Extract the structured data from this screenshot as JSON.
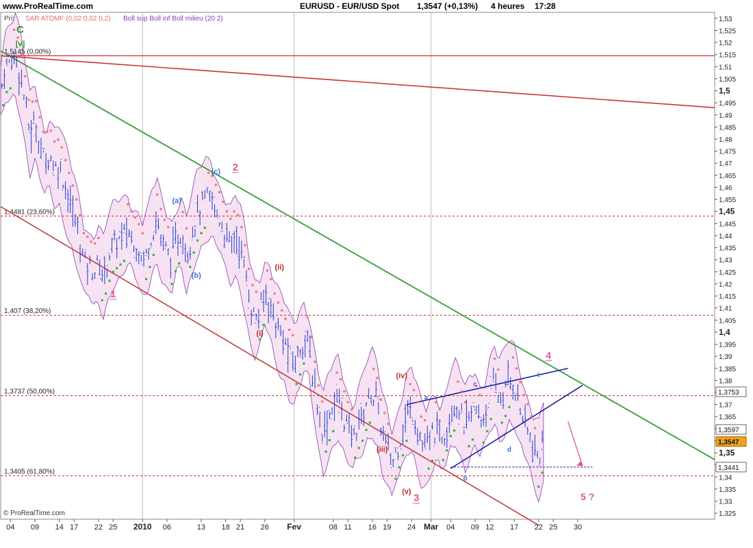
{
  "header": {
    "site": "www.ProRealTime.com",
    "title": "EURUSD - EUR/USD Spot",
    "price": "1,3547 (+0,13%)",
    "period": "4 heures",
    "time": "17:28"
  },
  "legend": {
    "prix": "Prix",
    "sar": "SAR ATDMF (0,02 0,02 0,2)",
    "boll": "Boll sup Boll inf Boll milieu (20 2)"
  },
  "footer": {
    "copyright": "© ProRealTime.com"
  },
  "colors": {
    "price_bars": "#1f3fc8",
    "sar_up": "#33bb33",
    "sar_down": "#ee7777",
    "bollinger": "#8a3ab0",
    "bollinger_fill": "#f6e2f2",
    "upper_channel": "#cc3333",
    "green_line": "#3a9a3a",
    "lower_channel": "#c04040",
    "triangle": "#1a1aa0",
    "fib_line": "#c82020",
    "wave_pink": "#e0559a",
    "wave_red": "#c02828",
    "wave_blue": "#3a70d0",
    "wave_green": "#2e9a2e"
  },
  "chart_data": {
    "type": "line",
    "instrument": "EURUSD - EUR/USD Spot",
    "timeframe": "4 heures",
    "y_range": [
      1.3225,
      1.5325
    ],
    "y_ticks": [
      "1,53",
      "1,525",
      "1,52",
      "1,515",
      "1,51",
      "1,505",
      "1,5",
      "1,495",
      "1,49",
      "1,485",
      "1,48",
      "1,475",
      "1,47",
      "1,465",
      "1,46",
      "1,455",
      "1,45",
      "1,445",
      "1,44",
      "1,435",
      "1,43",
      "1,425",
      "1,42",
      "1,415",
      "1,41",
      "1,405",
      "1,4",
      "1,395",
      "1,39",
      "1,385",
      "1,38",
      "1,375",
      "1,37",
      "1,365",
      "1,36",
      "1,355",
      "1,35",
      "1,345",
      "1,34",
      "1,335",
      "1,33",
      "1,325"
    ],
    "y_bold_ticks": [
      "1,5",
      "1,45",
      "1,4",
      "1,35"
    ],
    "x_range": [
      0,
      146
    ],
    "x_ticks": [
      {
        "label": "04",
        "x": 2
      },
      {
        "label": "09",
        "x": 7
      },
      {
        "label": "14",
        "x": 12
      },
      {
        "label": "17",
        "x": 15
      },
      {
        "label": "22",
        "x": 20
      },
      {
        "label": "25",
        "x": 23
      },
      {
        "label": "2010",
        "x": 29,
        "bold": true
      },
      {
        "label": "06",
        "x": 34
      },
      {
        "label": "13",
        "x": 41
      },
      {
        "label": "18",
        "x": 46
      },
      {
        "label": "21",
        "x": 49
      },
      {
        "label": "26",
        "x": 54
      },
      {
        "label": "Fev",
        "x": 60,
        "bold": true
      },
      {
        "label": "08",
        "x": 68
      },
      {
        "label": "11",
        "x": 71
      },
      {
        "label": "16",
        "x": 76
      },
      {
        "label": "19",
        "x": 79
      },
      {
        "label": "24",
        "x": 84
      },
      {
        "label": "Mar",
        "x": 88,
        "bold": true
      },
      {
        "label": "04",
        "x": 92
      },
      {
        "label": "09",
        "x": 97
      },
      {
        "label": "12",
        "x": 100
      },
      {
        "label": "17",
        "x": 105
      },
      {
        "label": "22",
        "x": 110
      },
      {
        "label": "25",
        "x": 113
      },
      {
        "label": "30",
        "x": 118
      }
    ],
    "price_path": [
      [
        0,
        1.5
      ],
      [
        1,
        1.51
      ],
      [
        2,
        1.512
      ],
      [
        3,
        1.515
      ],
      [
        4,
        1.507
      ],
      [
        5,
        1.495
      ],
      [
        6,
        1.482
      ],
      [
        7,
        1.487
      ],
      [
        8,
        1.478
      ],
      [
        9,
        1.47
      ],
      [
        10,
        1.474
      ],
      [
        11,
        1.468
      ],
      [
        12,
        1.469
      ],
      [
        13,
        1.462
      ],
      [
        14,
        1.455
      ],
      [
        15,
        1.448
      ],
      [
        16,
        1.44
      ],
      [
        17,
        1.43
      ],
      [
        18,
        1.428
      ],
      [
        19,
        1.425
      ],
      [
        20,
        1.428
      ],
      [
        21,
        1.423
      ],
      [
        22,
        1.431
      ],
      [
        23,
        1.436
      ],
      [
        24,
        1.438
      ],
      [
        25,
        1.44
      ],
      [
        26,
        1.442
      ],
      [
        27,
        1.438
      ],
      [
        28,
        1.435
      ],
      [
        29,
        1.43
      ],
      [
        30,
        1.434
      ],
      [
        31,
        1.442
      ],
      [
        32,
        1.446
      ],
      [
        33,
        1.438
      ],
      [
        34,
        1.433
      ],
      [
        35,
        1.431
      ],
      [
        36,
        1.438
      ],
      [
        37,
        1.441
      ],
      [
        38,
        1.432
      ],
      [
        39,
        1.44
      ],
      [
        40,
        1.448
      ],
      [
        41,
        1.452
      ],
      [
        42,
        1.455
      ],
      [
        43,
        1.455
      ],
      [
        44,
        1.45
      ],
      [
        45,
        1.446
      ],
      [
        46,
        1.44
      ],
      [
        47,
        1.436
      ],
      [
        48,
        1.44
      ],
      [
        49,
        1.435
      ],
      [
        50,
        1.425
      ],
      [
        51,
        1.412
      ],
      [
        52,
        1.405
      ],
      [
        53,
        1.408
      ],
      [
        54,
        1.416
      ],
      [
        55,
        1.413
      ],
      [
        56,
        1.405
      ],
      [
        57,
        1.4
      ],
      [
        58,
        1.396
      ],
      [
        59,
        1.39
      ],
      [
        60,
        1.387
      ],
      [
        61,
        1.392
      ],
      [
        62,
        1.398
      ],
      [
        63,
        1.394
      ],
      [
        64,
        1.38
      ],
      [
        65,
        1.367
      ],
      [
        66,
        1.358
      ],
      [
        67,
        1.365
      ],
      [
        68,
        1.37
      ],
      [
        69,
        1.373
      ],
      [
        70,
        1.366
      ],
      [
        71,
        1.36
      ],
      [
        72,
        1.356
      ],
      [
        73,
        1.362
      ],
      [
        74,
        1.366
      ],
      [
        75,
        1.372
      ],
      [
        76,
        1.375
      ],
      [
        77,
        1.37
      ],
      [
        78,
        1.358
      ],
      [
        79,
        1.353
      ],
      [
        80,
        1.345
      ],
      [
        81,
        1.352
      ],
      [
        82,
        1.358
      ],
      [
        83,
        1.366
      ],
      [
        84,
        1.368
      ],
      [
        85,
        1.362
      ],
      [
        86,
        1.354
      ],
      [
        87,
        1.352
      ],
      [
        88,
        1.357
      ],
      [
        89,
        1.36
      ],
      [
        90,
        1.356
      ],
      [
        91,
        1.36
      ],
      [
        92,
        1.368
      ],
      [
        93,
        1.371
      ],
      [
        94,
        1.366
      ],
      [
        95,
        1.36
      ],
      [
        96,
        1.365
      ],
      [
        97,
        1.368
      ],
      [
        98,
        1.363
      ],
      [
        99,
        1.366
      ],
      [
        100,
        1.374
      ],
      [
        101,
        1.378
      ],
      [
        102,
        1.372
      ],
      [
        103,
        1.375
      ],
      [
        104,
        1.38
      ],
      [
        105,
        1.378
      ],
      [
        106,
        1.37
      ],
      [
        107,
        1.363
      ],
      [
        108,
        1.358
      ],
      [
        109,
        1.35
      ],
      [
        110,
        1.347
      ],
      [
        111,
        1.3547
      ]
    ],
    "fib_levels": [
      {
        "label": "1,5145 (0,00%)",
        "value": 1.5145
      },
      {
        "label": "1,4481 (23,60%)",
        "value": 1.4481
      },
      {
        "label": "1,407 (38,20%)",
        "value": 1.407
      },
      {
        "label": "1,3737 (50,00%)",
        "value": 1.3737
      },
      {
        "label": "1,3405 (61,80%)",
        "value": 1.3405
      }
    ],
    "trend_lines": [
      {
        "from": [
          0,
          1.5145
        ],
        "to": [
          146,
          1.493
        ]
      },
      {
        "from": [
          0,
          1.5165
        ],
        "to": [
          146,
          1.3472
        ]
      },
      {
        "from": [
          0,
          1.452
        ],
        "to": [
          110,
          1.32
        ]
      },
      {
        "from": [
          92,
          1.3435
        ],
        "to": [
          119,
          1.378
        ]
      },
      {
        "from": [
          83,
          1.37
        ],
        "to": [
          116,
          1.385
        ]
      }
    ],
    "price_labels": [
      {
        "label": "1,3753",
        "value": 1.3753
      },
      {
        "label": "1,3597",
        "value": 1.3597
      },
      {
        "label": "1,3547",
        "value": 1.3547,
        "current": true
      },
      {
        "label": "1,3441",
        "value": 1.3441
      }
    ],
    "wave_labels": [
      {
        "label": "C",
        "x": 4,
        "value": 1.524,
        "color": "green",
        "size": 15
      },
      {
        "label": "[v]",
        "x": 4,
        "value": 1.5185,
        "color": "green",
        "size": 11
      },
      {
        "label": "1",
        "x": 23,
        "value": 1.4145,
        "color": "pink",
        "size": 15
      },
      {
        "label": "2",
        "x": 48,
        "value": 1.467,
        "color": "pink",
        "size": 15
      },
      {
        "label": "3",
        "x": 85,
        "value": 1.33,
        "color": "pink",
        "size": 15
      },
      {
        "label": "4",
        "x": 112,
        "value": 1.389,
        "color": "pink",
        "size": 14
      },
      {
        "label": "5 ?",
        "x": 120,
        "value": 1.3305,
        "color": "pink",
        "size": 14
      },
      {
        "label": "(a)",
        "x": 36,
        "value": 1.4535,
        "color": "blue",
        "size": 11
      },
      {
        "label": "(b)",
        "x": 40,
        "value": 1.4225,
        "color": "blue",
        "size": 11
      },
      {
        "label": "(c)",
        "x": 44,
        "value": 1.4655,
        "color": "blue",
        "size": 11
      },
      {
        "label": "(i)",
        "x": 53,
        "value": 1.3985,
        "color": "red",
        "size": 11
      },
      {
        "label": "(ii)",
        "x": 57,
        "value": 1.426,
        "color": "red",
        "size": 11
      },
      {
        "label": "(iii)",
        "x": 78,
        "value": 1.3505,
        "color": "red",
        "size": 11
      },
      {
        "label": "(iv)",
        "x": 82,
        "value": 1.381,
        "color": "red",
        "size": 11
      },
      {
        "label": "(v)",
        "x": 83,
        "value": 1.333,
        "color": "red",
        "size": 11
      },
      {
        "label": "a",
        "x": 87,
        "value": 1.372,
        "color": "blue",
        "size": 10
      },
      {
        "label": "b",
        "x": 95,
        "value": 1.3385,
        "color": "blue",
        "size": 10
      },
      {
        "label": "c",
        "x": 97,
        "value": 1.3775,
        "color": "blue",
        "size": 10
      },
      {
        "label": "d",
        "x": 104,
        "value": 1.3505,
        "color": "blue",
        "size": 10
      },
      {
        "label": "e",
        "x": 110,
        "value": 1.3815,
        "color": "blue",
        "size": 10
      }
    ],
    "target_arrow": {
      "from": [
        116,
        1.363
      ],
      "to": [
        119,
        1.3445
      ]
    },
    "support_level": 1.3441,
    "grid": "vertical lines at 2010, Fev, Mar"
  }
}
